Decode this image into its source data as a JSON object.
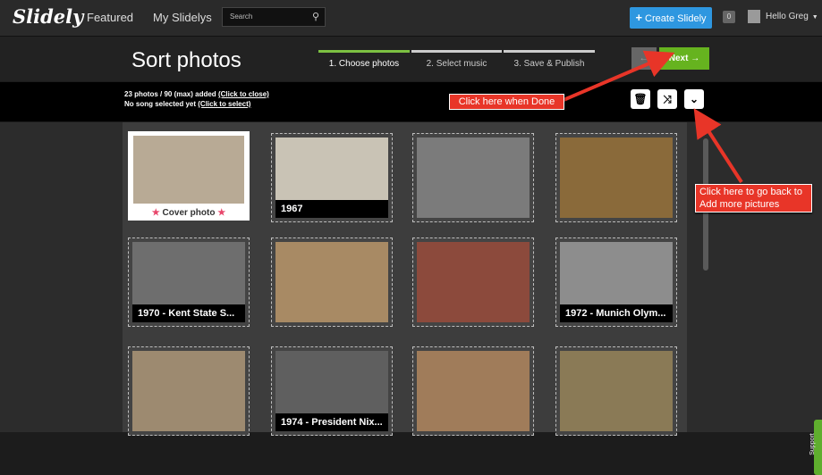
{
  "header": {
    "logo": "Slidely",
    "nav": [
      "Featured",
      "My Slidelys"
    ],
    "search_placeholder": "Search",
    "create_label": "Create Slidely",
    "notif_count": "0",
    "greeting": "Hello Greg"
  },
  "page": {
    "title": "Sort photos",
    "steps": [
      {
        "label": "1. Choose photos",
        "active": true
      },
      {
        "label": "2. Select music",
        "active": false
      },
      {
        "label": "3. Save & Publish",
        "active": false
      }
    ],
    "back_label": "←",
    "next_label": "Next →"
  },
  "info": {
    "photos_text": "23 photos / 90 (max) added",
    "close_link": "(Click to close)",
    "song_text": "No song selected yet",
    "select_link": "(Click to select)"
  },
  "toolbar": {
    "delete_icon": "🗑",
    "shuffle_icon": "⤨",
    "collapse_icon": "⌄"
  },
  "annotations": {
    "done": "Click here when Done",
    "go_back": "Click here to go back to Add more pictures"
  },
  "photos": [
    {
      "caption": "Cover photo",
      "cover": true,
      "color": "#b8aa95"
    },
    {
      "caption": "1967",
      "color": "#c9c3b5"
    },
    {
      "caption": "",
      "color": "#7b7b7b"
    },
    {
      "caption": "",
      "color": "#8a6a3a"
    },
    {
      "caption": "1970 - Kent State S...",
      "color": "#6e6e6e"
    },
    {
      "caption": "",
      "color": "#a88a64"
    },
    {
      "caption": "",
      "color": "#8c4a3c"
    },
    {
      "caption": "1972 - Munich Olym...",
      "color": "#8d8d8d"
    },
    {
      "caption": "",
      "color": "#9d8a70"
    },
    {
      "caption": "1974 - President Nix...",
      "color": "#5f5f5f"
    },
    {
      "caption": "",
      "color": "#a07c5a"
    },
    {
      "caption": "",
      "color": "#8a7a56"
    }
  ],
  "support_label": "Support"
}
